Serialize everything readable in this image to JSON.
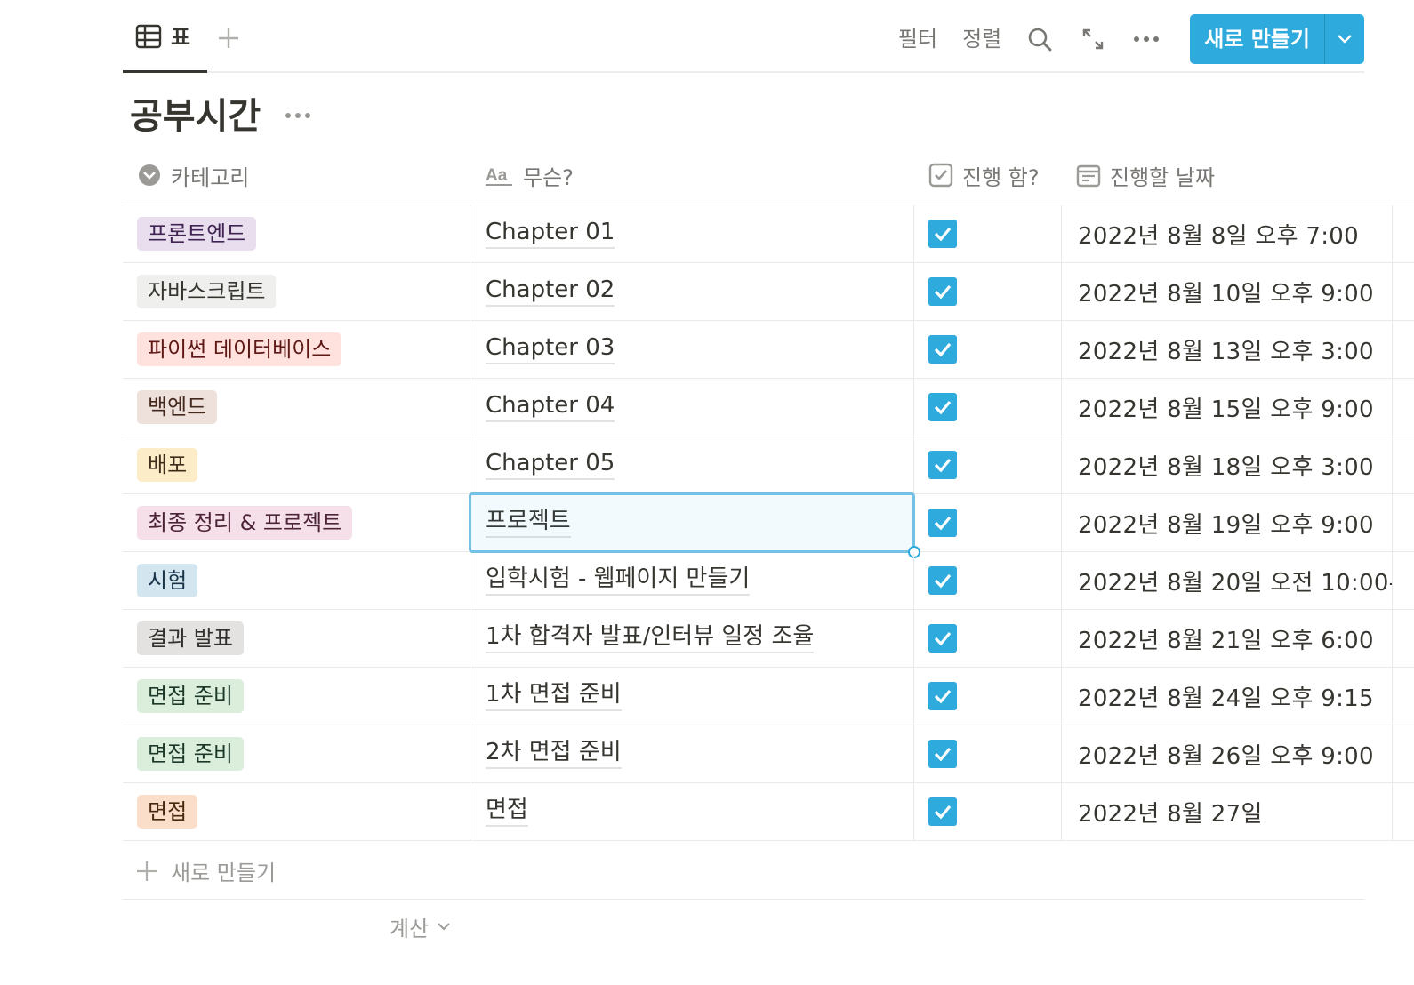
{
  "view_tab": {
    "label": "표",
    "icon": "table-icon"
  },
  "toolbar": {
    "filter": "필터",
    "sort": "정렬",
    "new_button": "새로 만들기",
    "accent": "#2eaadc"
  },
  "database": {
    "title": "공부시간"
  },
  "columns": [
    {
      "label": "카테고리",
      "icon": "select-property-icon"
    },
    {
      "label": "무슨?",
      "icon": "text-property-icon"
    },
    {
      "label": "진행 함?",
      "icon": "checkbox-property-icon"
    },
    {
      "label": "진행할 날짜",
      "icon": "date-property-icon"
    }
  ],
  "rows": [
    {
      "category": "프론트엔드",
      "tag_bg": "#e8deee",
      "tag_fg": "#412454",
      "title": "Chapter 01",
      "done": true,
      "date": "2022년 8월 8일 오후 7:00"
    },
    {
      "category": "자바스크립트",
      "tag_bg": "#efefed",
      "tag_fg": "#37352f",
      "title": "Chapter 02",
      "done": true,
      "date": "2022년 8월 10일 오후 9:00"
    },
    {
      "category": "파이썬 데이터베이스",
      "tag_bg": "#ffe2dd",
      "tag_fg": "#5d1715",
      "title": "Chapter 03",
      "done": true,
      "date": "2022년 8월 13일 오후 3:00"
    },
    {
      "category": "백엔드",
      "tag_bg": "#eee0da",
      "tag_fg": "#442a1e",
      "title": "Chapter 04",
      "done": true,
      "date": "2022년 8월 15일 오후 9:00"
    },
    {
      "category": "배포",
      "tag_bg": "#fdecc8",
      "tag_fg": "#402c1b",
      "title": "Chapter 05",
      "done": true,
      "date": "2022년 8월 18일 오후 3:00"
    },
    {
      "category": "최종 정리 & 프로젝트",
      "tag_bg": "#f5e0e9",
      "tag_fg": "#4c2337",
      "title": "프로젝트",
      "done": true,
      "date": "2022년 8월 19일 오후 9:00"
    },
    {
      "category": "시험",
      "tag_bg": "#d3e5ef",
      "tag_fg": "#183347",
      "title": "입학시험 - 웹페이지 만들기",
      "done": true,
      "date": "2022년 8월 20일 오전 10:00-"
    },
    {
      "category": "결과 발표",
      "tag_bg": "#e3e2e0",
      "tag_fg": "#32302c",
      "title": "1차 합격자 발표/인터뷰 일정 조율",
      "done": true,
      "date": "2022년 8월 21일 오후 6:00"
    },
    {
      "category": "면접 준비",
      "tag_bg": "#dbeddb",
      "tag_fg": "#1c3829",
      "title": "1차 면접 준비",
      "done": true,
      "date": "2022년 8월 24일 오후 9:15"
    },
    {
      "category": "면접 준비",
      "tag_bg": "#dbeddb",
      "tag_fg": "#1c3829",
      "title": "2차 면접 준비",
      "done": true,
      "date": "2022년 8월 26일 오후 9:00"
    },
    {
      "category": "면접",
      "tag_bg": "#fadec9",
      "tag_fg": "#49290e",
      "title": "면접",
      "done": true,
      "date": "2022년 8월 27일"
    }
  ],
  "footer": {
    "new_row": "새로 만들기",
    "calculate": "계산"
  }
}
